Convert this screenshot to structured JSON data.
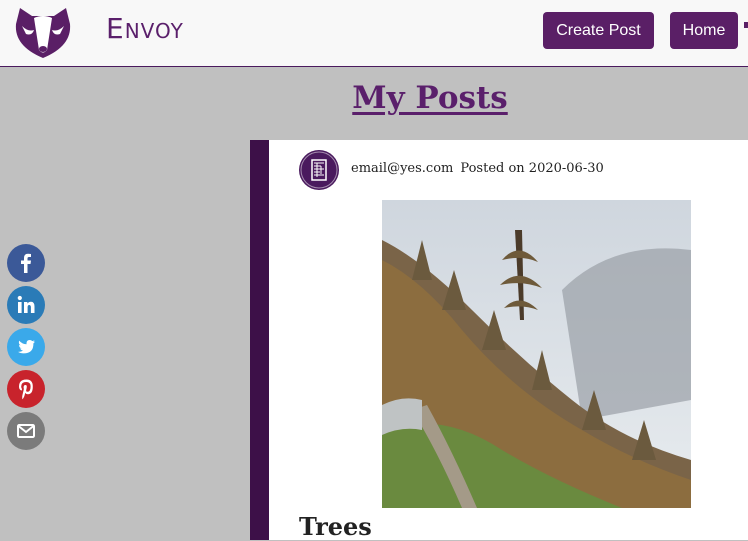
{
  "brand": {
    "name": "Envoy"
  },
  "nav": {
    "create_post": "Create Post",
    "home": "Home"
  },
  "page": {
    "title": "My Posts"
  },
  "post": {
    "author_email": "email@yes.com",
    "posted_on": "Posted on 2020-06-30",
    "title": "Trees"
  },
  "social": [
    {
      "name": "facebook-icon",
      "color": "#3b5998"
    },
    {
      "name": "linkedin-icon",
      "color": "#2a7bb7"
    },
    {
      "name": "twitter-icon",
      "color": "#3aa9ea"
    },
    {
      "name": "pinterest-icon",
      "color": "#c8232c"
    },
    {
      "name": "email-icon",
      "color": "#7b7b7b"
    }
  ],
  "colors": {
    "accent": "#5a1f66",
    "card_border": "#3d1048",
    "background": "#c0c0c0"
  }
}
